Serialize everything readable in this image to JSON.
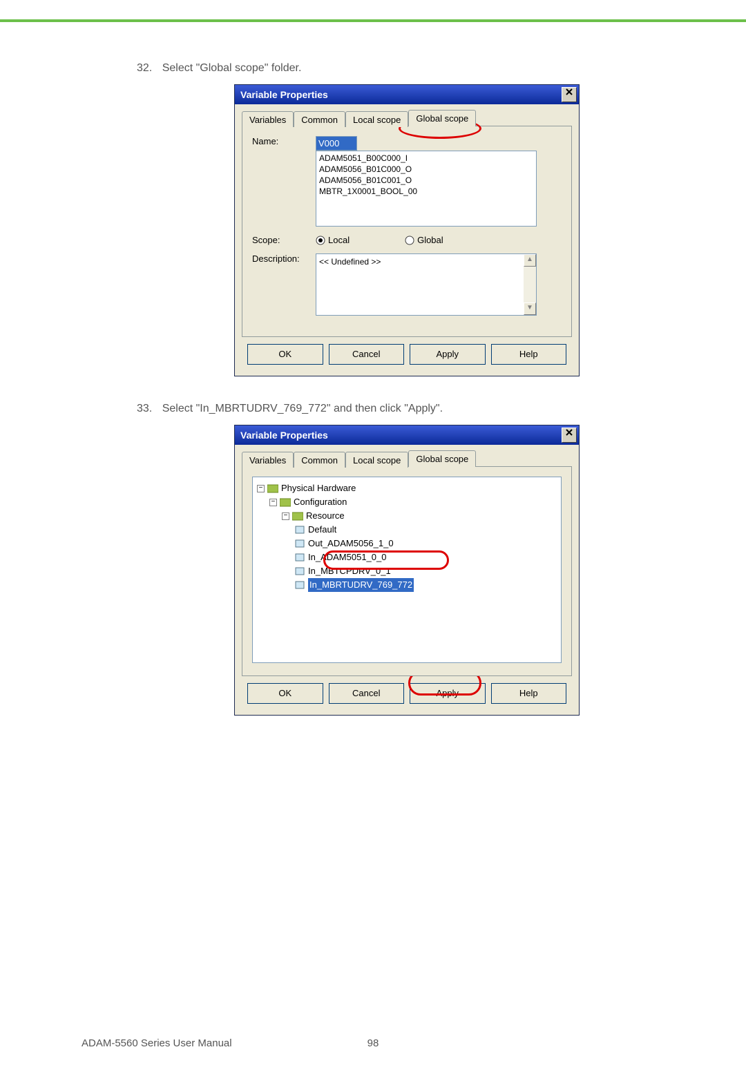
{
  "page": {
    "step32_num": "32.",
    "step32_text": "Select \"Global scope\" folder.",
    "step33_num": "33.",
    "step33_text": "Select \"In_MBRTUDRV_769_772\" and then click \"Apply\"."
  },
  "footer": {
    "left": "ADAM-5560 Series User Manual",
    "center": "98"
  },
  "dlg1": {
    "title": "Variable Properties",
    "tabs": {
      "t1": "Variables",
      "t2": "Common",
      "t3": "Local scope",
      "t4": "Global scope"
    },
    "name_label": "Name:",
    "name_value": "V000",
    "list_items": "ADAM5051_B00C000_I\nADAM5056_B01C000_O\nADAM5056_B01C001_O\nMBTR_1X0001_BOOL_00",
    "scope_label": "Scope:",
    "scope_local": "Local",
    "scope_global": "Global",
    "desc_label": "Description:",
    "desc_value": "<< Undefined >>",
    "btn_ok": "OK",
    "btn_cancel": "Cancel",
    "btn_apply": "Apply",
    "btn_help": "Help"
  },
  "dlg2": {
    "title": "Variable Properties",
    "tabs": {
      "t1": "Variables",
      "t2": "Common",
      "t3": "Local scope",
      "t4": "Global scope"
    },
    "tree": {
      "n0": "Physical Hardware",
      "n1": "Configuration",
      "n2": "Resource",
      "n3": "Default",
      "n4": "Out_ADAM5056_1_0",
      "n5": "In_ADAM5051_0_0",
      "n6": "In_MBTCPDRV_0_1",
      "n7": "In_MBRTUDRV_769_772"
    },
    "btn_ok": "OK",
    "btn_cancel": "Cancel",
    "btn_apply": "Apply",
    "btn_help": "Help"
  }
}
